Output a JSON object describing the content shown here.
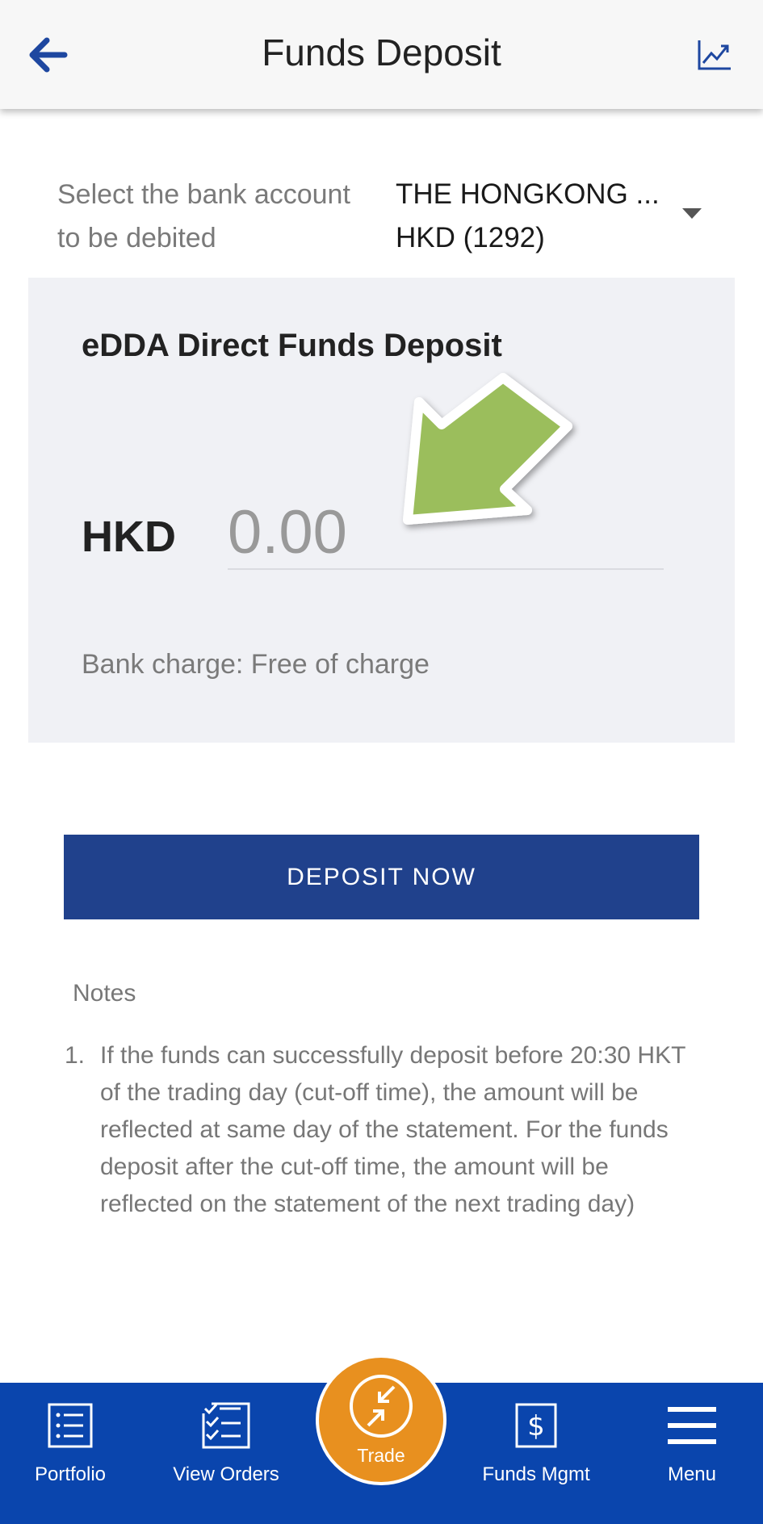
{
  "header": {
    "title": "Funds Deposit",
    "back_icon": "arrow-left-icon",
    "chart_icon": "chart-line-icon"
  },
  "bank_select": {
    "label": "Select the bank account to be debited",
    "bank_name": "THE HONGKONG ...",
    "account": "HKD (1292)"
  },
  "deposit_card": {
    "title": "eDDA Direct Funds Deposit",
    "currency": "HKD",
    "amount_placeholder": "0.00",
    "bank_charge": "Bank charge: Free of charge"
  },
  "deposit_button": {
    "label": "DEPOSIT NOW"
  },
  "notes": {
    "title": "Notes",
    "items": [
      {
        "number": "1.",
        "text": "If the funds can successfully deposit before 20:30 HKT of the trading day (cut-off time), the amount will be reflected at same day of the statement. For the funds deposit after the cut-off time, the amount will be reflected on the statement of the next trading day)"
      }
    ]
  },
  "bottom_nav": {
    "portfolio": "Portfolio",
    "view_orders": "View Orders",
    "trade": "Trade",
    "funds_mgmt": "Funds Mgmt",
    "menu": "Menu"
  },
  "colors": {
    "primary_blue": "#20418c",
    "nav_blue": "#0a45ad",
    "trade_orange": "#e8901f",
    "arrow_green": "#9bbe5b"
  }
}
